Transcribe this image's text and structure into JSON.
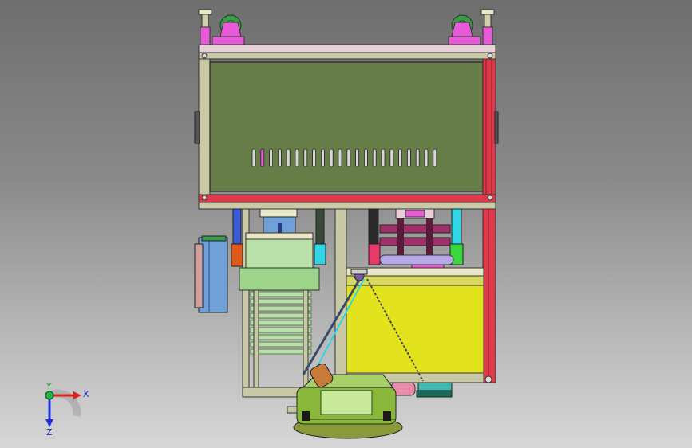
{
  "viewport": {
    "background_top": "#6e6e6e",
    "background_bottom": "#d6d6d6",
    "model_name": "",
    "colors": {
      "panel": "#667d47",
      "frame": "#c9c9a6",
      "red_rail": "#e03a4a",
      "magenta": "#e85ad7",
      "yellow": "#e3e31d",
      "green": "#9ed48c",
      "blue": "#6fa0d8",
      "cyan": "#31d6e6",
      "orange": "#e05a1a",
      "olive_base": "#8a9a3a"
    },
    "vent_slot_count": 22
  },
  "triad": {
    "x_label": "X",
    "y_label": "Y",
    "z_label": "Z"
  }
}
